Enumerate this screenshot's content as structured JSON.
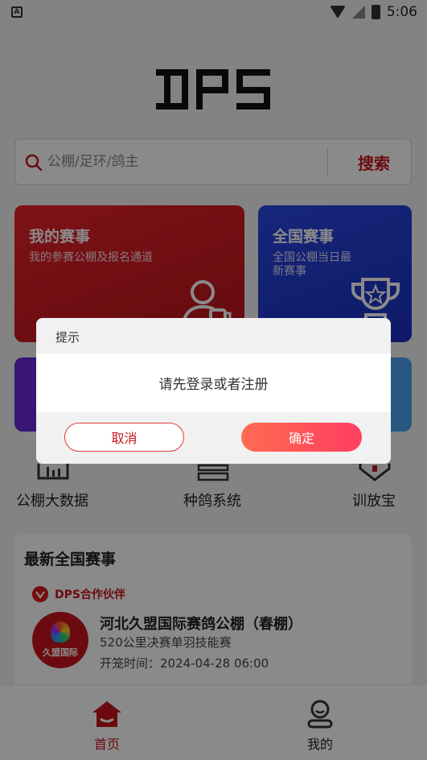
{
  "status_bar": {
    "time": "5:06",
    "app_indicator": "A"
  },
  "logo": {
    "text": "DPS"
  },
  "search": {
    "placeholder": "公棚/足环/鸽主",
    "button_label": "搜索"
  },
  "cards": {
    "my_races": {
      "title": "我的赛事",
      "subtitle": "我的参赛公棚及报名通道",
      "icon": "user-trophy-icon",
      "color": "#d81e25"
    },
    "national_races": {
      "title": "全国赛事",
      "subtitle": "全国公棚当日最新赛事",
      "icon": "trophy-icon",
      "color": "#2541d8"
    }
  },
  "quick_nav": [
    {
      "label": "公棚大数据",
      "icon": "chart-icon"
    },
    {
      "label": "种鸽系统",
      "icon": "stack-icon"
    },
    {
      "label": "训放宝",
      "icon": "pin-icon"
    }
  ],
  "latest": {
    "title": "最新全国赛事",
    "partner_label": "DPS合作伙伴",
    "item": {
      "logo_text": "久盟国际",
      "name": "河北久盟国际赛鸽公棚（春棚）",
      "race": "520公里决赛单羽技能赛",
      "start_time": "开笼时间：2024-04-28 06:00"
    }
  },
  "bottom_nav": [
    {
      "label": "首页",
      "icon": "home-icon",
      "active": true
    },
    {
      "label": "我的",
      "icon": "user-icon",
      "active": false
    }
  ],
  "dialog": {
    "title": "提示",
    "message": "请先登录或者注册",
    "cancel_label": "取消",
    "confirm_label": "确定"
  },
  "colors": {
    "brand_red": "#c8161d",
    "overlay": "rgba(0,0,0,0.46)"
  }
}
